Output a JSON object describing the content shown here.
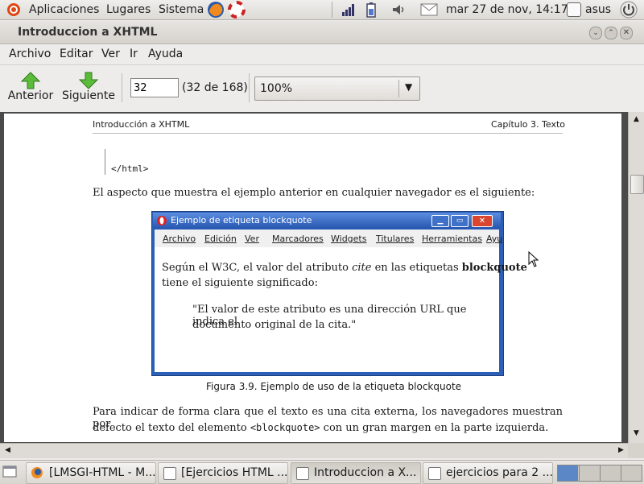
{
  "top_panel": {
    "applications": "Aplicaciones",
    "places": "Lugares",
    "system": "Sistema",
    "clock": "mar 27 de nov, 14:17",
    "user": "asus"
  },
  "window": {
    "title": "Introduccion a XHTML"
  },
  "menubar": {
    "file": "Archivo",
    "edit": "Editar",
    "view": "Ver",
    "go": "Ir",
    "help": "Ayuda"
  },
  "toolbar": {
    "previous": "Anterior",
    "next": "Siguiente",
    "page_value": "32",
    "page_of": "(32 de 168)",
    "zoom": "100%"
  },
  "document": {
    "header_left": "Introducción a XHTML",
    "header_right": "Capítulo 3. Texto",
    "code_line": "</html>",
    "para1": "El aspecto que muestra el ejemplo anterior en cualquier navegador es el siguiente:",
    "figure_caption": "Figura 3.9. Ejemplo de uso de la etiqueta blockquote",
    "para2_line1": "Para indicar de forma clara que el texto es una cita externa, los navegadores muestran por",
    "para2_line2_pre": "defecto el texto del elemento ",
    "para2_line2_code": "<blockquote>",
    "para2_line2_post": " con un gran margen en la parte izquierda.",
    "screenshot": {
      "title": "Ejemplo de etiqueta blockquote",
      "menu": [
        "Archivo",
        "Edición",
        "Ver",
        "Marcadores",
        "Widgets",
        "Titulares",
        "Herramientas",
        "Ayu"
      ],
      "text_pre": "Según el W3C, el valor del atributo ",
      "text_cite": "cite",
      "text_mid": " en las etiquetas ",
      "text_bold": "blockquote",
      "text_line2": "tiene el siguiente significado:",
      "quote_line1": "\"El valor de este atributo es una dirección URL que indica el",
      "quote_line2": "documento original de la cita.\""
    }
  },
  "taskbar": {
    "tasks": [
      "[LMSGI-HTML - M...",
      "[Ejercicios HTML ...",
      "Introduccion a X...",
      "ejercicios para 2 ..."
    ]
  },
  "colors": {
    "accent": "#2656b0",
    "arrow_green": "#4caa2a"
  }
}
